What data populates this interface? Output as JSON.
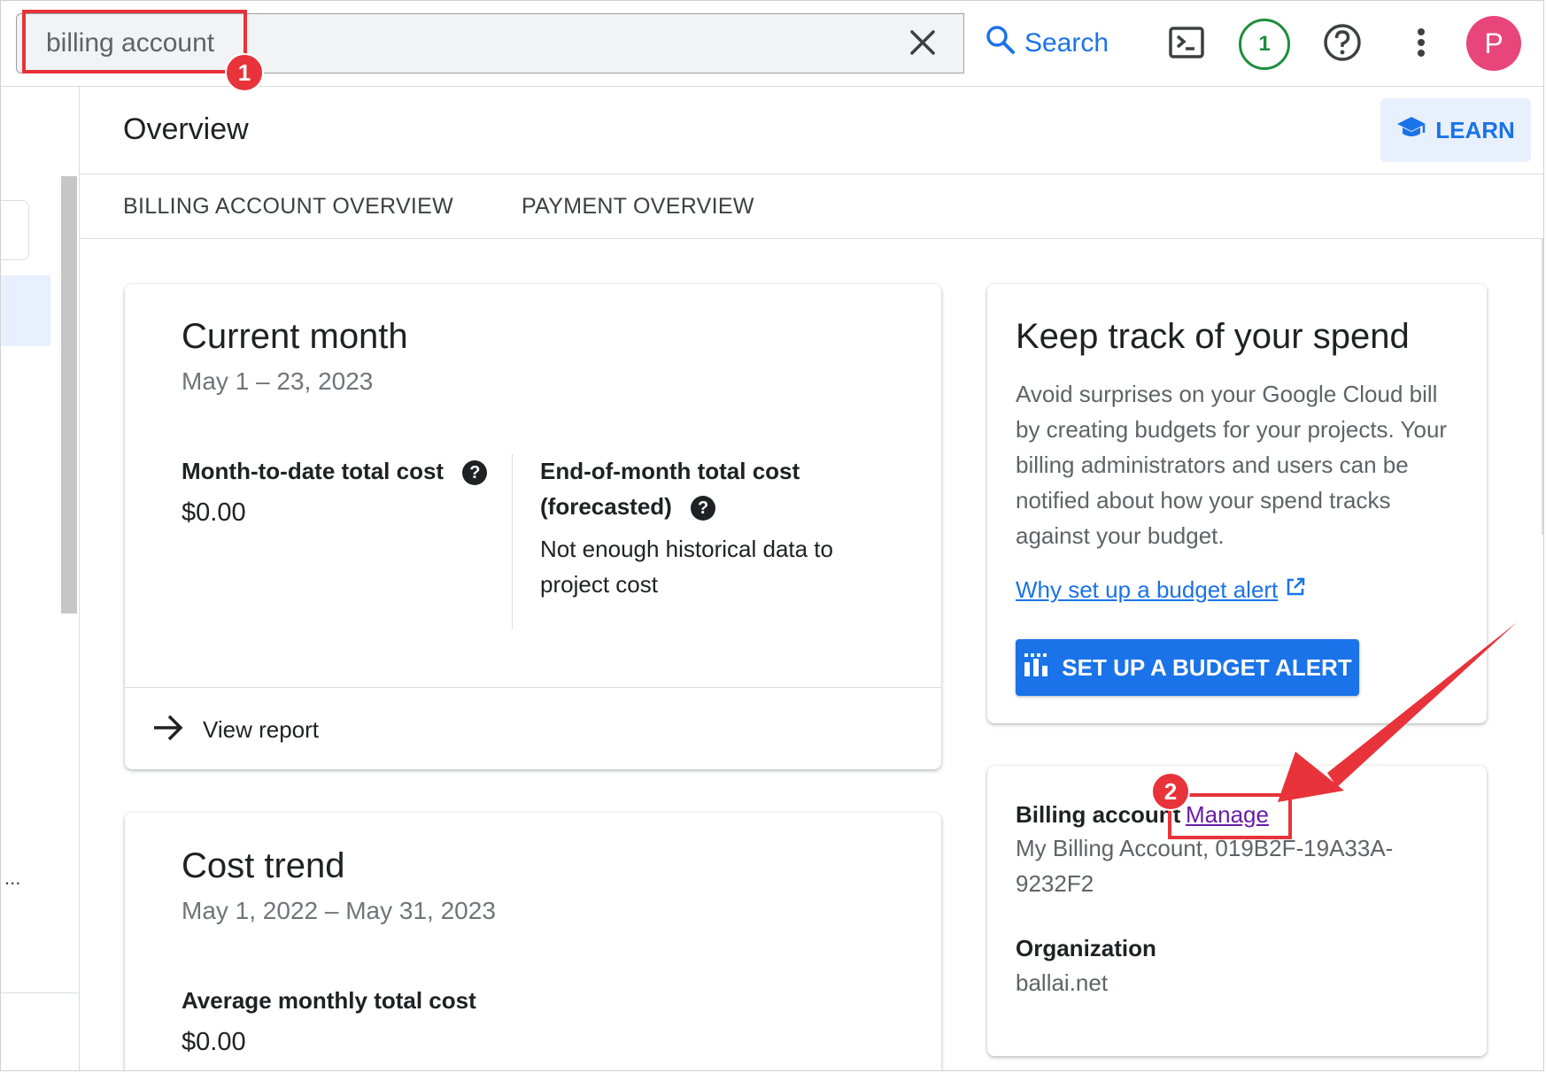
{
  "search": {
    "value": "billing account",
    "button_label": "Search"
  },
  "topbar": {
    "notification_count": "1",
    "avatar_initial": "P"
  },
  "sidebar": {
    "truncated_text": "..."
  },
  "header": {
    "title": "Overview",
    "learn_label": "LEARN"
  },
  "tabs": [
    {
      "label": "BILLING ACCOUNT OVERVIEW"
    },
    {
      "label": "PAYMENT OVERVIEW"
    }
  ],
  "current_month": {
    "title": "Current month",
    "date_range": "May 1 – 23, 2023",
    "mtd_label": "Month-to-date total cost",
    "mtd_value": "$0.00",
    "eom_label_1": "End-of-month total cost",
    "eom_label_2": "(forecasted)",
    "eom_text_1": "Not enough historical data to",
    "eom_text_2": "project cost",
    "view_report": "View report"
  },
  "cost_trend": {
    "title": "Cost trend",
    "date_range": "May 1, 2022 – May 31, 2023",
    "avg_label": "Average monthly total cost",
    "avg_value": "$0.00"
  },
  "budget_card": {
    "title": "Keep track of your spend",
    "desc_lines": [
      "Avoid surprises on your Google Cloud bill",
      "by creating budgets for your projects. Your",
      "billing administrators and users can be",
      "notified about how your spend tracks",
      "against your budget."
    ],
    "link_text": "Why set up a budget alert",
    "button_label": "SET UP A BUDGET ALERT"
  },
  "account_card": {
    "billing_label": "Billing account",
    "manage_link": "Manage",
    "account_line_1": "My Billing Account, 019B2F-19A33A-",
    "account_line_2": "9232F2",
    "org_label": "Organization",
    "org_value": "ballai.net"
  },
  "annotations": [
    {
      "number": "1"
    },
    {
      "number": "2"
    }
  ],
  "colors": {
    "accent": "#1a73e8",
    "annotation": "#e8333a",
    "avatar": "#e8457a",
    "badge": "#1e8e3e"
  }
}
